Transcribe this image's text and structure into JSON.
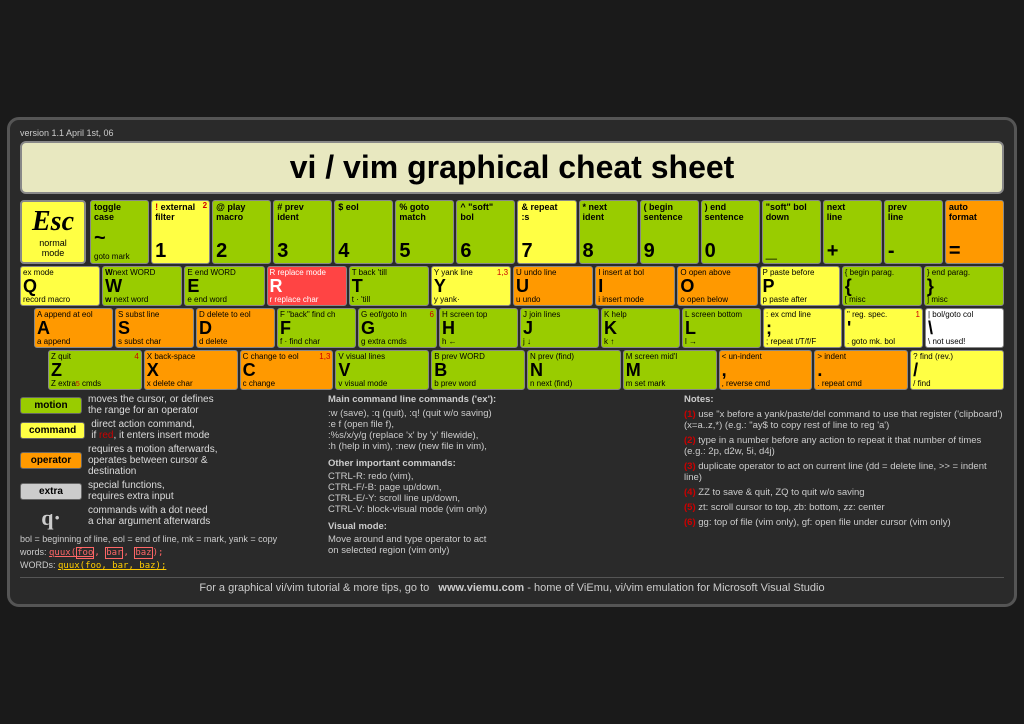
{
  "version": "version 1.1\nApril 1st, 06",
  "title": "vi / vim graphical cheat sheet",
  "esc": {
    "label": "Esc",
    "sub1": "normal",
    "sub2": "mode"
  },
  "numrow": [
    {
      "symbol": "~",
      "top1": "toggle",
      "top2": "case",
      "num": "",
      "super": ""
    },
    {
      "symbol": "!",
      "top1": "external",
      "top2": "filter",
      "num": "1",
      "super": "2"
    },
    {
      "symbol": "@",
      "top1": "play",
      "top2": "macro",
      "num": "2",
      "super": ""
    },
    {
      "symbol": "#",
      "top1": "prev",
      "top2": "ident",
      "num": "3",
      "super": ""
    },
    {
      "symbol": "$",
      "top1": "eol",
      "top2": "",
      "num": "4",
      "super": ""
    },
    {
      "symbol": "%",
      "top1": "goto",
      "top2": "match",
      "num": "5",
      "super": ""
    },
    {
      "symbol": "^",
      "top1": "\"soft\"",
      "top2": "bol",
      "num": "6",
      "super": ""
    },
    {
      "symbol": "&",
      "top1": "repeat",
      "top2": ":s",
      "num": "7",
      "super": ""
    },
    {
      "symbol": "*",
      "top1": "next",
      "top2": "ident",
      "num": "8",
      "super": ""
    },
    {
      "symbol": "(",
      "top1": "begin",
      "top2": "sentence",
      "num": "9",
      "super": ""
    },
    {
      "symbol": ")",
      "top1": "end",
      "top2": "sentence",
      "num": "0",
      "super": ""
    },
    {
      "symbol": "_",
      "top1": "\"soft\" bol",
      "top2": "down",
      "num": "",
      "super": ""
    },
    {
      "symbol": "+",
      "top1": "next",
      "top2": "line",
      "num": "",
      "super": ""
    },
    {
      "symbol": "-",
      "top1": "prev",
      "top2": "line",
      "num": "",
      "super": ""
    },
    {
      "symbol": "=",
      "top1": "auto",
      "top2": "format",
      "num": "",
      "super": ""
    }
  ],
  "qrow": [
    {
      "letter": "Q",
      "upper": "ex mode",
      "lower": "record macro",
      "color": "green"
    },
    {
      "letter": "W",
      "upper": "next WORD",
      "lower": "next word",
      "color": "green"
    },
    {
      "letter": "E",
      "upper": "end WORD",
      "lower": "end word",
      "color": "green"
    },
    {
      "letter": "R",
      "upper": "replace mode",
      "lower": "replace char",
      "color": "red"
    },
    {
      "letter": "T",
      "upper": "back 'till",
      "lower": "· 'till",
      "color": "green"
    },
    {
      "letter": "Y",
      "upper": "yank line",
      "lower": "yank·",
      "color": "yellow",
      "super": "1,3"
    },
    {
      "letter": "U",
      "upper": "undo line",
      "lower": "undo",
      "color": "orange"
    },
    {
      "letter": "I",
      "upper": "insert at bol",
      "lower": "insert mode",
      "color": "orange"
    },
    {
      "letter": "O",
      "upper": "open above",
      "lower": "open below",
      "color": "orange"
    },
    {
      "letter": "P",
      "upper": "paste before",
      "lower": "paste after",
      "color": "yellow"
    },
    {
      "letter": "{",
      "upper": "begin parag.",
      "lower": "misc",
      "color": "green"
    },
    {
      "letter": "}",
      "upper": "end parag.",
      "lower": "misc",
      "color": "green"
    }
  ],
  "arow": [
    {
      "letter": "A",
      "upper": "append at eol",
      "lower": "append",
      "color": "orange"
    },
    {
      "letter": "S",
      "upper": "subst line",
      "lower": "subst char",
      "color": "orange"
    },
    {
      "letter": "D",
      "upper": "delete to eol",
      "lower": "delete",
      "color": "orange"
    },
    {
      "letter": "F",
      "upper": "\"back\" find ch",
      "lower": "find char",
      "color": "green"
    },
    {
      "letter": "G",
      "upper": "eof/goto ln",
      "lower": "extra cmds",
      "color": "green",
      "super": "6"
    },
    {
      "letter": "H",
      "upper": "screen top",
      "lower": "←",
      "color": "green"
    },
    {
      "letter": "J",
      "upper": "join lines",
      "lower": "↓",
      "color": "green"
    },
    {
      "letter": "K",
      "upper": "help",
      "lower": "↑",
      "color": "green"
    },
    {
      "letter": "L",
      "upper": "screen bottom",
      "lower": "→",
      "color": "green"
    },
    {
      "letter": ":",
      "upper": "ex cmd line",
      "lower": "repeat t/T/f/F",
      "color": "yellow"
    },
    {
      "letter": "\"",
      "upper": "reg. spec.",
      "lower": "goto mk. bol",
      "super": "1",
      "color": "yellow"
    },
    {
      "letter": "|",
      "upper": "bol/goto col",
      "lower": "not used!",
      "color": "white"
    }
  ],
  "zrow": [
    {
      "letter": "Z",
      "upper": "quit",
      "lower": "extra cmds",
      "color": "green",
      "super": "4,5"
    },
    {
      "letter": "X",
      "upper": "back-space",
      "lower": "delete char",
      "color": "orange"
    },
    {
      "letter": "C",
      "upper": "change to eol",
      "lower": "change",
      "color": "orange",
      "super": "1,3"
    },
    {
      "letter": "V",
      "upper": "visual lines",
      "lower": "visual mode",
      "color": "green"
    },
    {
      "letter": "B",
      "upper": "prev WORD",
      "lower": "prev word",
      "color": "green"
    },
    {
      "letter": "N",
      "upper": "prev (find)",
      "lower": "next (find)",
      "color": "green"
    },
    {
      "letter": "M",
      "upper": "screen mid'l",
      "lower": "set mark",
      "color": "green"
    },
    {
      "letter": "<",
      "upper": "un-indent",
      "lower": "reverse cmd",
      "color": "orange"
    },
    {
      "letter": ">",
      "upper": "indent",
      "lower": "repeat cmd",
      "color": "orange"
    },
    {
      "letter": "?",
      "upper": "find (rev.)",
      "lower": "find",
      "color": "yellow"
    }
  ],
  "legend": [
    {
      "badge": "motion",
      "color": "#99cc00",
      "text": "moves the cursor, or defines the range for an operator"
    },
    {
      "badge": "command",
      "color": "#ffff44",
      "text": "direct action command, if red, it enters insert mode"
    },
    {
      "badge": "operator",
      "color": "#ff9900",
      "text": "requires a motion afterwards, operates between cursor & destination"
    },
    {
      "badge": "extra",
      "color": "#cccccc",
      "text": "special functions, requires extra input"
    }
  ],
  "main_commands": {
    "title": "Main command line commands ('ex'):",
    "lines": [
      ":w (save), :q (quit), :q! (quit w/o saving)",
      ":e f (open file f),",
      ":%s/x/y/g (replace 'x' by 'y' filewide),",
      ":h (help in vim), :new (new file in vim),"
    ],
    "other_title": "Other important commands:",
    "other_lines": [
      "CTRL-R: redo (vim),",
      "CTRL-F/-B: page up/down,",
      "CTRL-E/-Y: scroll line up/down,",
      "CTRL-V: block-visual mode (vim only)"
    ],
    "visual_title": "Visual mode:",
    "visual_lines": [
      "Move around and type operator to act",
      "on selected region (vim only)"
    ]
  },
  "notes": {
    "title": "Notes:",
    "items": [
      {
        "num": "(1)",
        "text": "use \"x before a yank/paste/del command to use that register ('clipboard') (x=a..z,*) (e.g.: \"ay$ to copy rest of line to reg 'a')"
      },
      {
        "num": "(2)",
        "text": "type in a number before any action to repeat it that number of times (e.g.: 2p, d2w, 5i, d4j)"
      },
      {
        "num": "(3)",
        "text": "duplicate operator to act on current line (dd = delete line, >> = indent line)"
      },
      {
        "num": "(4)",
        "text": "ZZ to save & quit, ZQ to quit w/o saving"
      },
      {
        "num": "(5)",
        "text": "zt: scroll cursor to top, zb: bottom, zz: center"
      },
      {
        "num": "(6)",
        "text": "gg: top of file (vim only), gf: open file under cursor (vim only)"
      }
    ]
  },
  "footer": {
    "text1": "For a graphical vi/vim tutorial & more tips, go to",
    "url": "www.viemu.com",
    "text2": " - home of ViEmu, vi/vim emulation for Microsoft Visual Studio"
  },
  "words_line": "bol = beginning of line, eol = end of line, mk = mark, yank = copy",
  "words_example": "words:  quux(foo, bar, baz);",
  "words_example2": "WORDs:  quux(foo, bar, baz);"
}
